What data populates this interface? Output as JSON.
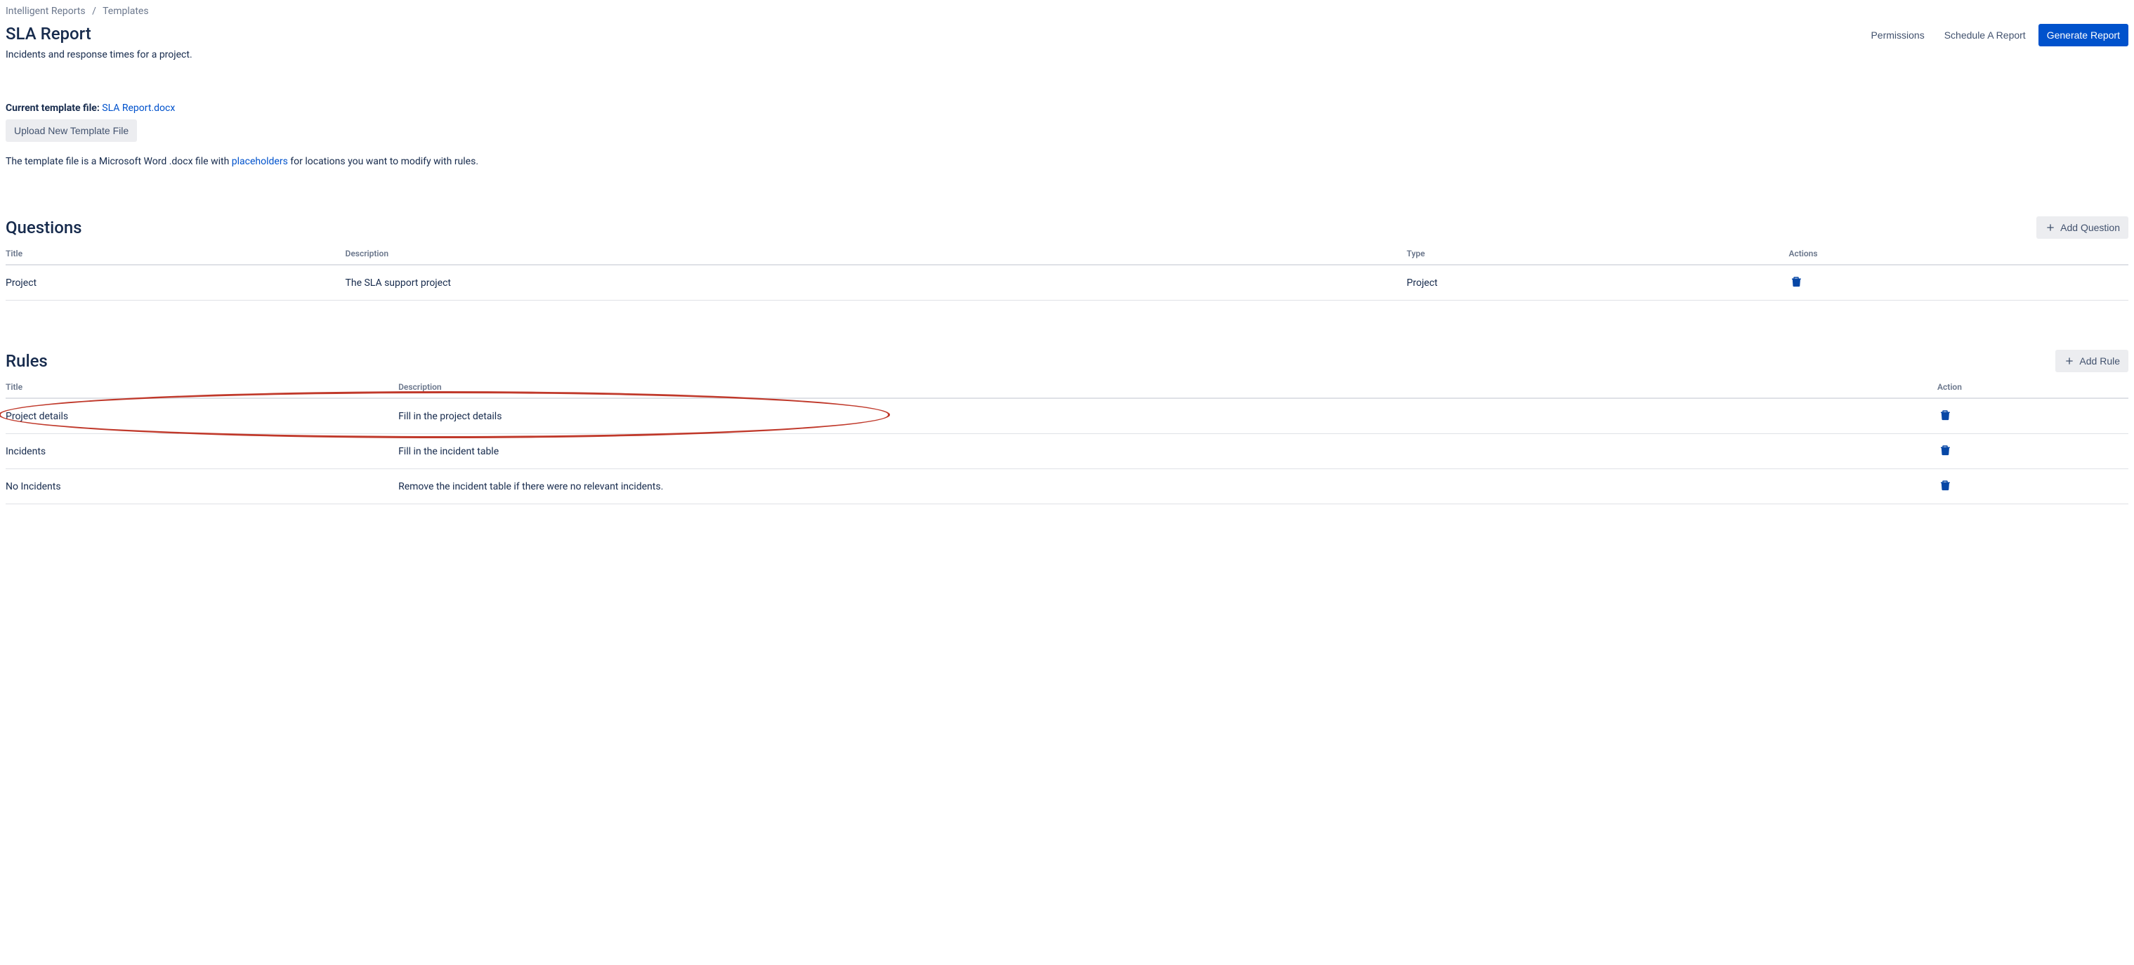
{
  "breadcrumb": {
    "root": "Intelligent Reports",
    "current": "Templates"
  },
  "page": {
    "title": "SLA Report",
    "subtitle": "Incidents and response times for a project."
  },
  "header_actions": {
    "permissions": "Permissions",
    "schedule": "Schedule A Report",
    "generate": "Generate Report"
  },
  "template_file": {
    "label": "Current template file:",
    "filename": "SLA Report.docx",
    "upload_button": "Upload New Template File",
    "help_prefix": "The template file is a Microsoft Word .docx file with ",
    "help_link": "placeholders",
    "help_suffix": " for locations you want to modify with rules."
  },
  "questions_section": {
    "title": "Questions",
    "add_button": "Add Question",
    "headers": {
      "title": "Title",
      "description": "Description",
      "type": "Type",
      "actions": "Actions"
    },
    "rows": [
      {
        "title": "Project",
        "description": "The SLA support project",
        "type": "Project"
      }
    ]
  },
  "rules_section": {
    "title": "Rules",
    "add_button": "Add Rule",
    "headers": {
      "title": "Title",
      "description": "Description",
      "action": "Action"
    },
    "rows": [
      {
        "title": "Project details",
        "description": "Fill in the project details"
      },
      {
        "title": "Incidents",
        "description": "Fill in the incident table"
      },
      {
        "title": "No Incidents",
        "description": "Remove the incident table if there were no relevant incidents."
      }
    ]
  }
}
